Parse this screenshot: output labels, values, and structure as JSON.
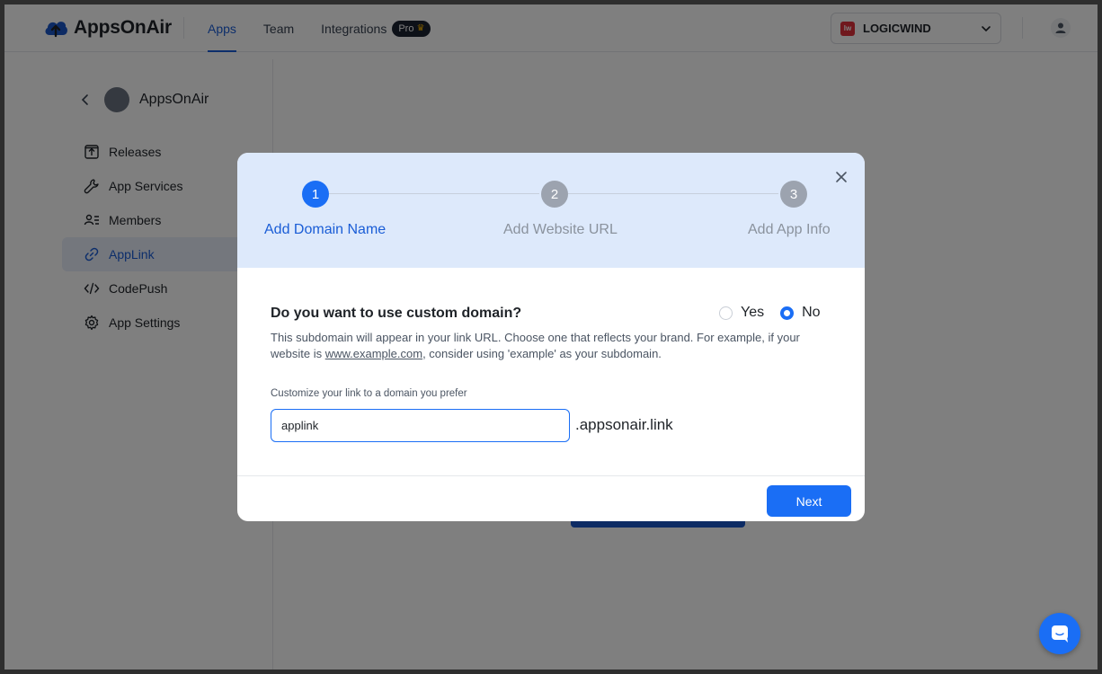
{
  "header": {
    "app_name": "AppsOnAir",
    "nav": [
      {
        "label": "Apps",
        "active": true
      },
      {
        "label": "Team",
        "active": false
      },
      {
        "label": "Integrations",
        "active": false
      }
    ],
    "pro_badge": "Pro",
    "org_name": "LOGICWIND",
    "org_logo_text": "lw"
  },
  "sidebar": {
    "app_name": "AppsOnAir",
    "items": [
      {
        "label": "Releases",
        "icon": "releases-icon"
      },
      {
        "label": "App Services",
        "icon": "wrench-icon"
      },
      {
        "label": "Members",
        "icon": "members-icon"
      },
      {
        "label": "AppLink",
        "icon": "link-icon",
        "active": true
      },
      {
        "label": "CodePush",
        "icon": "code-icon"
      },
      {
        "label": "App Settings",
        "icon": "gear-icon"
      }
    ]
  },
  "modal": {
    "steps": [
      {
        "number": "1",
        "label": "Add Domain Name",
        "active": true
      },
      {
        "number": "2",
        "label": "Add Website URL",
        "active": false
      },
      {
        "number": "3",
        "label": "Add App Info",
        "active": false
      }
    ],
    "question": "Do you want to use custom domain?",
    "options": [
      {
        "label": "Yes",
        "checked": false
      },
      {
        "label": "No",
        "checked": true
      }
    ],
    "description_before": "This subdomain will appear in your link URL. Choose one that reflects your brand. For example, if your website is ",
    "description_link": "www.example.com",
    "description_after": ", consider using 'example' as your subdomain.",
    "field_label": "Customize your link to a domain you prefer",
    "input_value": "applink",
    "domain_suffix": ".appsonair.link",
    "next_label": "Next"
  },
  "colors": {
    "accent": "#1a6ef5",
    "step_band": "#dde9fb"
  }
}
